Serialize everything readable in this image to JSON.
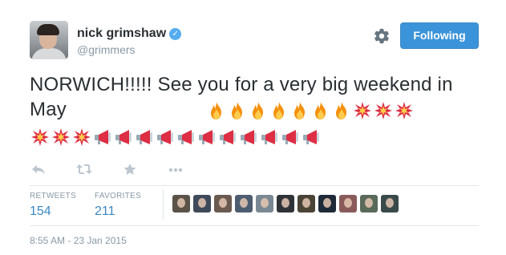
{
  "user": {
    "name": "nick grimshaw",
    "handle": "@grimmers",
    "verified_mark": "✓"
  },
  "follow_button": {
    "label": "Following"
  },
  "tweet": {
    "text": "NORWICH!!!!! See you for a very big weekend in May",
    "emoji_line_1": [
      "fire",
      "fire",
      "fire",
      "fire",
      "fire",
      "fire",
      "fire",
      "collision",
      "collision",
      "collision"
    ],
    "emoji_line_2": [
      "collision",
      "collision",
      "collision",
      "megaphone",
      "megaphone",
      "megaphone",
      "megaphone",
      "megaphone",
      "megaphone",
      "megaphone",
      "megaphone",
      "megaphone",
      "megaphone",
      "megaphone"
    ]
  },
  "actions": [
    "reply-icon",
    "retweet-icon",
    "favorite-icon",
    "more-icon"
  ],
  "stats": {
    "retweets_label": "RETWEETS",
    "retweets_count": "154",
    "favorites_label": "FAVORITES",
    "favorites_count": "211"
  },
  "favoriters": [
    "#5b5248",
    "#3e4a5a",
    "#6b5a50",
    "#4c5d70",
    "#7a8894",
    "#2f3338",
    "#4a4437",
    "#1f2a38",
    "#8a5a5a",
    "#5a6a5a",
    "#3a4a4a"
  ],
  "timestamp": "8:55 AM - 23 Jan 2015",
  "colors": {
    "accent": "#3b94d9",
    "link": "#3b88c3",
    "muted": "#8899a6"
  }
}
